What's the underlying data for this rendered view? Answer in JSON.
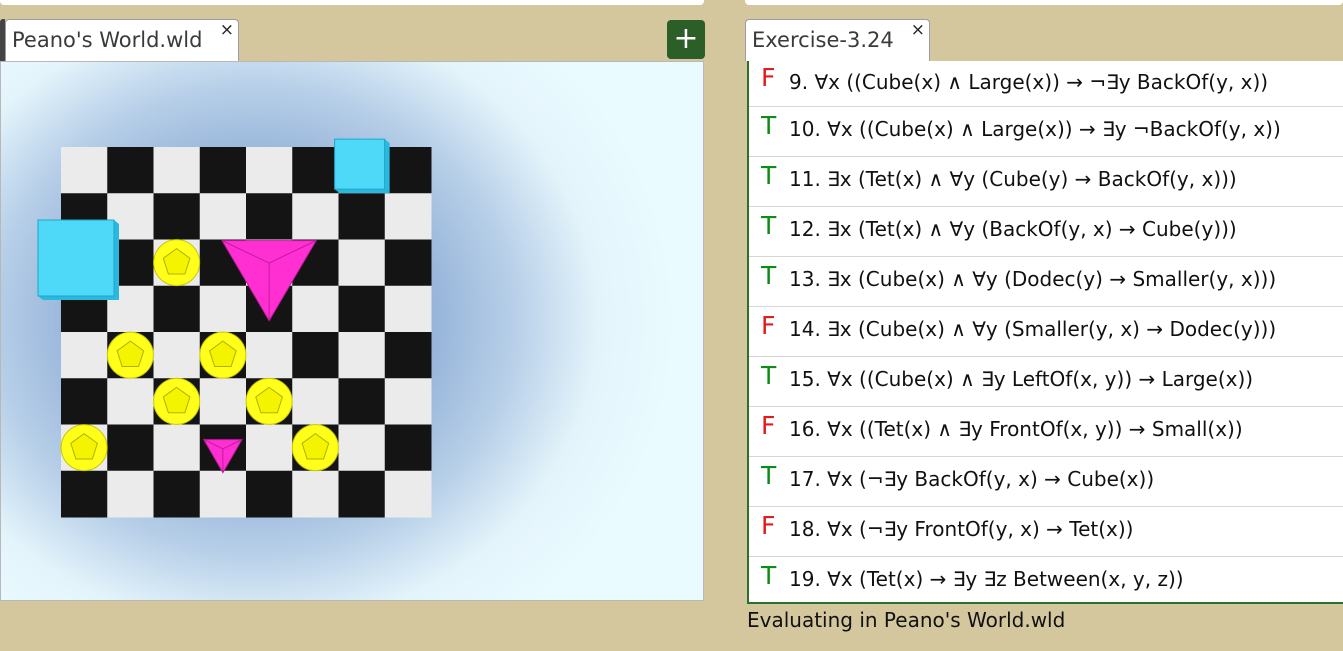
{
  "world_tab": {
    "title": "Peano's World.wld",
    "close": "×"
  },
  "add_tab": {
    "label": "+"
  },
  "exercise_tab": {
    "title": "Exercise-3.24",
    "close": "×"
  },
  "sentences": [
    {
      "value": "F",
      "text": " 9.  ∀x ((Cube(x) ∧ Large(x)) → ¬∃y BackOf(y, x))"
    },
    {
      "value": "T",
      "text": "10. ∀x ((Cube(x) ∧ Large(x)) → ∃y ¬BackOf(y, x))"
    },
    {
      "value": "T",
      "text": "11. ∃x (Tet(x) ∧ ∀y (Cube(y) → BackOf(y, x)))"
    },
    {
      "value": "T",
      "text": "12. ∃x (Tet(x) ∧ ∀y (BackOf(y, x) → Cube(y)))"
    },
    {
      "value": "T",
      "text": "13. ∃x (Cube(x) ∧ ∀y (Dodec(y) → Smaller(y, x)))"
    },
    {
      "value": "F",
      "text": "14. ∃x (Cube(x) ∧ ∀y (Smaller(y, x) → Dodec(y)))"
    },
    {
      "value": "T",
      "text": "15. ∀x ((Cube(x) ∧ ∃y LeftOf(x, y)) → Large(x))"
    },
    {
      "value": "F",
      "text": "16. ∀x ((Tet(x) ∧ ∃y FrontOf(x, y)) → Small(x))"
    },
    {
      "value": "T",
      "text": "17. ∀x (¬∃y BackOf(y, x) → Cube(x))"
    },
    {
      "value": "F",
      "text": "18. ∀x (¬∃y FrontOf(y, x) → Tet(x))"
    },
    {
      "value": "T",
      "text": "19. ∀x (Tet(x) → ∃y ∃z Between(x, y, z))"
    }
  ],
  "status": {
    "text": "Evaluating in Peano's World.wld"
  },
  "colors": {
    "true": "#0e8a16",
    "false": "#e01b1b",
    "cube": "#4dd9f7",
    "tet": "#ff2fd2",
    "dodec": "#ffff1a",
    "board_dark": "#141414",
    "board_light": "#ebebeb",
    "accent_green": "#2c5e27"
  },
  "world": {
    "board_rows": 8,
    "board_cols": 8,
    "objects": [
      {
        "shape": "cube",
        "size": "small",
        "col": 6,
        "row": 0
      },
      {
        "shape": "cube",
        "size": "large",
        "col": 0,
        "row": 2
      },
      {
        "shape": "tet",
        "size": "large",
        "col": 4,
        "row": 2
      },
      {
        "shape": "dodec",
        "size": "small",
        "col": 2,
        "row": 2
      },
      {
        "shape": "dodec",
        "size": "small",
        "col": 1,
        "row": 4
      },
      {
        "shape": "dodec",
        "size": "small",
        "col": 3,
        "row": 4
      },
      {
        "shape": "dodec",
        "size": "small",
        "col": 2,
        "row": 5
      },
      {
        "shape": "dodec",
        "size": "small",
        "col": 4,
        "row": 5
      },
      {
        "shape": "dodec",
        "size": "small",
        "col": 0,
        "row": 6
      },
      {
        "shape": "tet",
        "size": "small",
        "col": 3,
        "row": 6
      },
      {
        "shape": "dodec",
        "size": "small",
        "col": 5,
        "row": 6
      }
    ]
  }
}
